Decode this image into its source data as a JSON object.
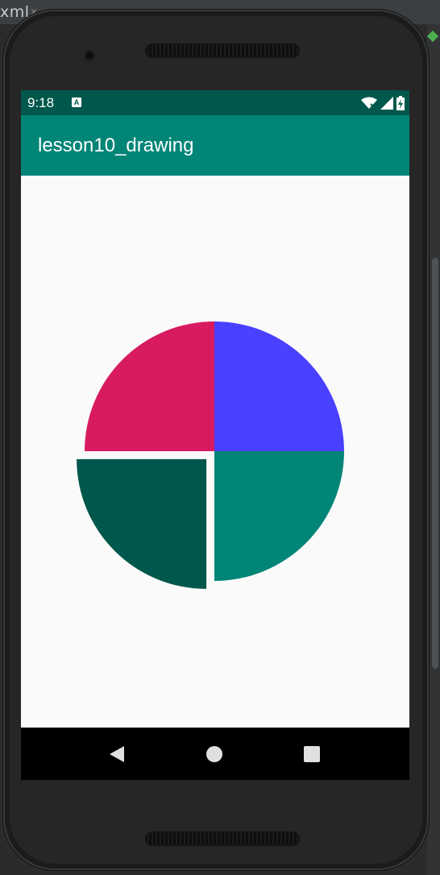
{
  "ide": {
    "tab_label": "xml",
    "tab_close": "×"
  },
  "status_bar": {
    "time": "9:18",
    "notification_icon_letter": "A",
    "icons": [
      "wifi-icon",
      "signal-icon",
      "battery-charging-icon"
    ]
  },
  "app_bar": {
    "title": "lesson10_drawing"
  },
  "colors": {
    "status_bar": "#00574b",
    "app_bar": "#008577",
    "background": "#fafafa",
    "slice_blue": "#4a40ff",
    "slice_pink": "#d81b60",
    "slice_dark_teal": "#00574b",
    "slice_teal": "#008577"
  },
  "chart_data": {
    "type": "pie",
    "values": [
      25,
      25,
      25,
      25
    ],
    "colors": [
      "#4a40ff",
      "#008577",
      "#00574b",
      "#d81b60"
    ],
    "exploded": [
      false,
      false,
      true,
      false
    ]
  },
  "nav_bar": {
    "buttons": [
      "back-icon",
      "home-icon",
      "recents-icon"
    ]
  }
}
